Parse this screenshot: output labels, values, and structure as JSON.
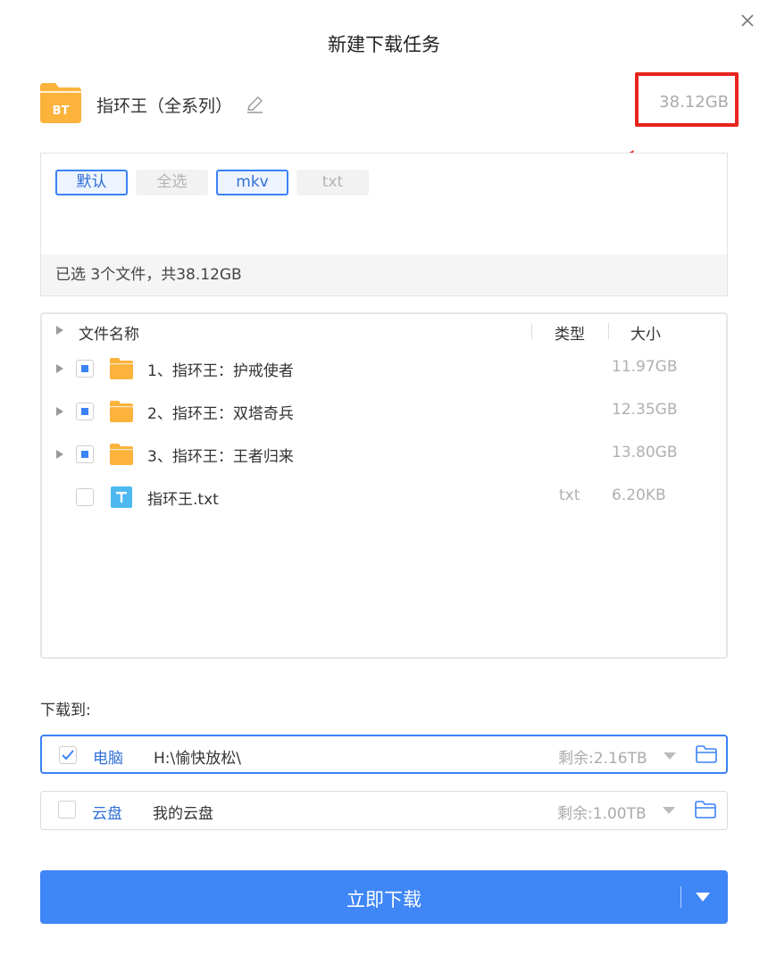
{
  "dialog": {
    "title": "新建下载任务",
    "task_name": "指环王（全系列）",
    "total_size": "38.12GB",
    "bt_badge": "BT"
  },
  "filters": {
    "buttons": [
      {
        "label": "默认",
        "state": "active"
      },
      {
        "label": "全选",
        "state": "inactive"
      },
      {
        "label": "mkv",
        "state": "active"
      },
      {
        "label": "txt",
        "state": "inactive"
      }
    ],
    "summary": "已选 3个文件，共38.12GB"
  },
  "file_list": {
    "headers": {
      "name": "文件名称",
      "type": "类型",
      "size": "大小"
    },
    "rows": [
      {
        "name": "1、指环王：护戒使者",
        "type": "",
        "size": "11.97GB",
        "kind": "folder",
        "checked": "partial"
      },
      {
        "name": "2、指环王：双塔奇兵",
        "type": "",
        "size": "12.35GB",
        "kind": "folder",
        "checked": "partial"
      },
      {
        "name": "3、指环王：王者归来",
        "type": "",
        "size": "13.80GB",
        "kind": "folder",
        "checked": "partial"
      },
      {
        "name": "指环王.txt",
        "type": "txt",
        "size": "6.20KB",
        "kind": "text-file",
        "checked": "unchecked"
      }
    ]
  },
  "destination": {
    "label": "下载到:",
    "options": [
      {
        "name": "电脑",
        "path": "H:\\愉快放松\\",
        "free": "剩余:2.16TB",
        "checked": true
      },
      {
        "name": "云盘",
        "path": "我的云盘",
        "free": "剩余:1.00TB",
        "checked": false
      }
    ]
  },
  "actions": {
    "download_label": "立即下载"
  },
  "colors": {
    "accent": "#3f86f7",
    "folder": "#fbb33c",
    "annotation_red": "#e8241c",
    "text_file_icon": "#4db8f0"
  }
}
